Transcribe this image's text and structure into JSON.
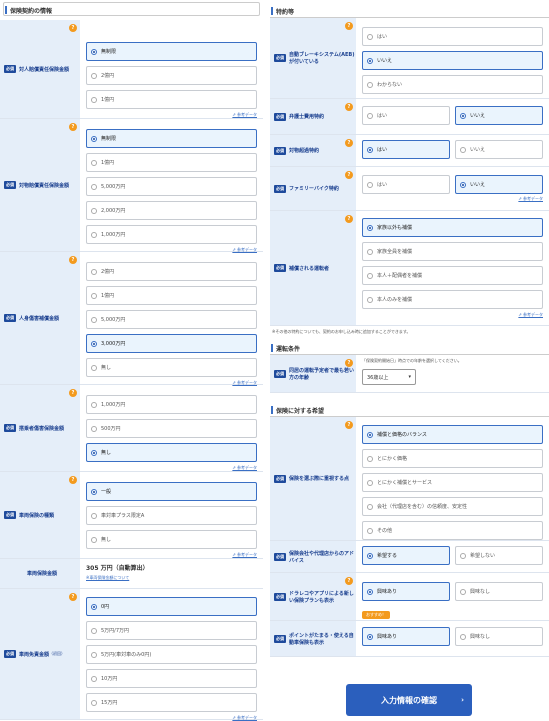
{
  "left": {
    "section_title": "保険契約の情報",
    "required": "必須",
    "help": "?",
    "ref": "参考データ",
    "liability_person": {
      "label": "対人賠償責任保険金額",
      "options": [
        "無制限",
        "2億円",
        "1億円"
      ],
      "selected": 0
    },
    "liability_property": {
      "label": "対物賠償責任保険金額",
      "options": [
        "無制限",
        "1億円",
        "5,000万円",
        "2,000万円",
        "1,000万円"
      ],
      "selected": 0
    },
    "injury": {
      "label": "人身傷害補償金額",
      "options": [
        "2億円",
        "1億円",
        "5,000万円",
        "3,000万円",
        "無し"
      ],
      "selected": 3
    },
    "passenger": {
      "label": "搭乗者傷害保険金額",
      "options": [
        "1,000万円",
        "500万円",
        "無し"
      ],
      "selected": 2
    },
    "vehicle_type": {
      "label": "車両保険の種類",
      "options": [
        "一般",
        "車対車プラス限定A",
        "無し"
      ],
      "selected": 0
    },
    "vehicle_amount": {
      "label": "車両保険金額",
      "value": "305 万円（自動算出）",
      "link": "※車両保険金額について"
    },
    "deductible": {
      "label": "車両免責金額",
      "label_sub": "（初回）",
      "options": [
        "0円",
        "5万円/7万円",
        "5万円(車対車のみ0円)",
        "10万円",
        "15万円"
      ],
      "selected": 0
    }
  },
  "right": {
    "special_title": "特約等",
    "aeb": {
      "label": "自動ブレーキシステム(AEB)が付いている",
      "options": [
        "はい",
        "いいえ",
        "わからない"
      ],
      "selected": 1
    },
    "lawyer": {
      "label": "弁護士費用特約",
      "options": [
        "はい",
        "いいえ"
      ],
      "selected": 1
    },
    "property_over": {
      "label": "対物超過特約",
      "options": [
        "はい",
        "いいえ"
      ],
      "selected": 0
    },
    "bike": {
      "label": "ファミリーバイク特約",
      "options": [
        "はい",
        "いいえ"
      ],
      "selected": 1
    },
    "driver_scope": {
      "label": "補償される運転者",
      "options": [
        "家族以外も補償",
        "家族全員を補償",
        "本人＋配偶者を補償",
        "本人のみを補償"
      ],
      "selected": 0
    },
    "other_note": "※その他の特約についても、契約のお申し込み時に追加することができます。",
    "driving_title": "運転条件",
    "age": {
      "label": "同居の運転予定者で最も若い方の年齢",
      "hint": "「保険契約開始日」時点での年齢を選択してください。",
      "value": "36歳以上"
    },
    "wish_title": "保険に対する希望",
    "priority": {
      "label": "保険を選ぶ際に重視する点",
      "options": [
        "補償と価格のバランス",
        "とにかく価格",
        "とにかく補償とサービス",
        "会社（代理店を含む）の信頼度、安定性",
        "その他"
      ],
      "selected": 0
    },
    "advice": {
      "label": "保険会社や代理店からのアドバイス",
      "options": [
        "希望する",
        "希望しない"
      ],
      "selected": 0
    },
    "recorder": {
      "label": "ドラレコやアプリによる新しい保険プランも表示",
      "options": [
        "興味あり",
        "興味なし"
      ],
      "selected": 0,
      "badge": "おすすめ！"
    },
    "points": {
      "label": "ポイントがたまる・使える自動車保険も表示",
      "options": [
        "興味あり",
        "興味なし"
      ],
      "selected": 0
    }
  },
  "submit": {
    "label": "入力情報の確認",
    "chevron": "›"
  }
}
